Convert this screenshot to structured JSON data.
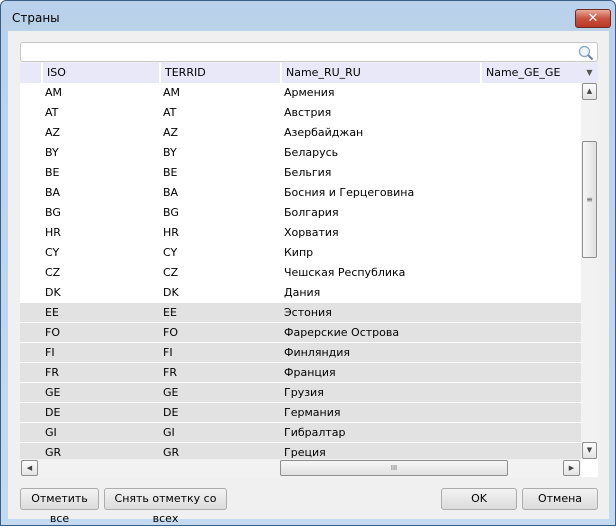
{
  "window": {
    "title": "Страны",
    "close_icon": "close-icon"
  },
  "search": {
    "value": "",
    "placeholder": "",
    "icon": "search-icon"
  },
  "table": {
    "columns": [
      "ISO",
      "TERRID",
      "Name_RU_RU",
      "Name_GE_GE"
    ],
    "rows": [
      {
        "iso": "AM",
        "terrid": "AM",
        "name_ru": "Армения",
        "name_ge": "",
        "selected": false
      },
      {
        "iso": "AT",
        "terrid": "AT",
        "name_ru": "Австрия",
        "name_ge": "",
        "selected": false
      },
      {
        "iso": "AZ",
        "terrid": "AZ",
        "name_ru": "Азербайджан",
        "name_ge": "",
        "selected": false
      },
      {
        "iso": "BY",
        "terrid": "BY",
        "name_ru": "Беларусь",
        "name_ge": "",
        "selected": false
      },
      {
        "iso": "BE",
        "terrid": "BE",
        "name_ru": "Бельгия",
        "name_ge": "",
        "selected": false
      },
      {
        "iso": "BA",
        "terrid": "BA",
        "name_ru": "Босния и Герцеговина",
        "name_ge": "",
        "selected": false
      },
      {
        "iso": "BG",
        "terrid": "BG",
        "name_ru": "Болгария",
        "name_ge": "",
        "selected": false
      },
      {
        "iso": "HR",
        "terrid": "HR",
        "name_ru": "Хорватия",
        "name_ge": "",
        "selected": false
      },
      {
        "iso": "CY",
        "terrid": "CY",
        "name_ru": "Кипр",
        "name_ge": "",
        "selected": false
      },
      {
        "iso": "CZ",
        "terrid": "CZ",
        "name_ru": "Чешская Республика",
        "name_ge": "",
        "selected": false
      },
      {
        "iso": "DK",
        "terrid": "DK",
        "name_ru": "Дания",
        "name_ge": "",
        "selected": false
      },
      {
        "iso": "EE",
        "terrid": "EE",
        "name_ru": "Эстония",
        "name_ge": "",
        "selected": true
      },
      {
        "iso": "FO",
        "terrid": "FO",
        "name_ru": "Фарерские Острова",
        "name_ge": "",
        "selected": true
      },
      {
        "iso": "FI",
        "terrid": "FI",
        "name_ru": "Финляндия",
        "name_ge": "",
        "selected": true
      },
      {
        "iso": "FR",
        "terrid": "FR",
        "name_ru": "Франция",
        "name_ge": "",
        "selected": true
      },
      {
        "iso": "GE",
        "terrid": "GE",
        "name_ru": "Грузия",
        "name_ge": "",
        "selected": true
      },
      {
        "iso": "DE",
        "terrid": "DE",
        "name_ru": "Германия",
        "name_ge": "",
        "selected": true
      },
      {
        "iso": "GI",
        "terrid": "GI",
        "name_ru": "Гибралтар",
        "name_ge": "",
        "selected": true
      },
      {
        "iso": "GR",
        "terrid": "GR",
        "name_ru": "Греция",
        "name_ge": "",
        "selected": true
      }
    ],
    "selected_row_color": "#e2e2e2",
    "header_color": "#e8e8f8"
  },
  "buttons": {
    "check_all": "Отметить все",
    "uncheck_all": "Снять отметку со всех",
    "ok": "OK",
    "cancel": "Отмена"
  }
}
